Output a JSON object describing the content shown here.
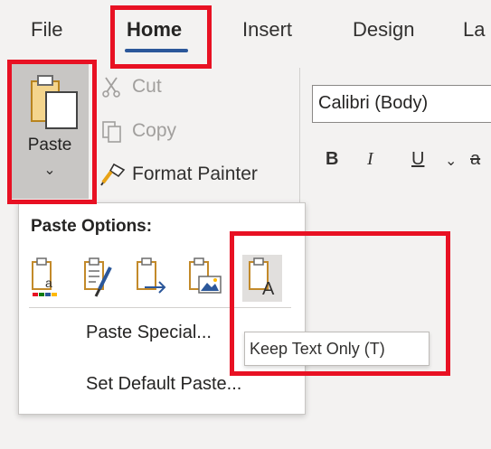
{
  "tabs": [
    {
      "label": "File"
    },
    {
      "label": "Home"
    },
    {
      "label": "Insert"
    },
    {
      "label": "Design"
    },
    {
      "label": "La"
    }
  ],
  "clipboard": {
    "paste_label": "Paste",
    "paste_chevron": "⌄",
    "cut_label": "Cut",
    "copy_label": "Copy",
    "format_painter_label": "Format Painter"
  },
  "font": {
    "name": "Calibri (Body)",
    "bold": "B",
    "italic": "I",
    "underline": "U",
    "underline_chevron": "⌄",
    "strike": "a"
  },
  "paste_menu": {
    "title": "Paste Options:",
    "special_label": "Paste Special...",
    "default_label": "Set Default Paste...",
    "tooltip": "Keep Text Only (T)"
  },
  "colors": {
    "accent": "#2b579a",
    "highlight": "#e81123",
    "hover": "#e1dfdd"
  }
}
